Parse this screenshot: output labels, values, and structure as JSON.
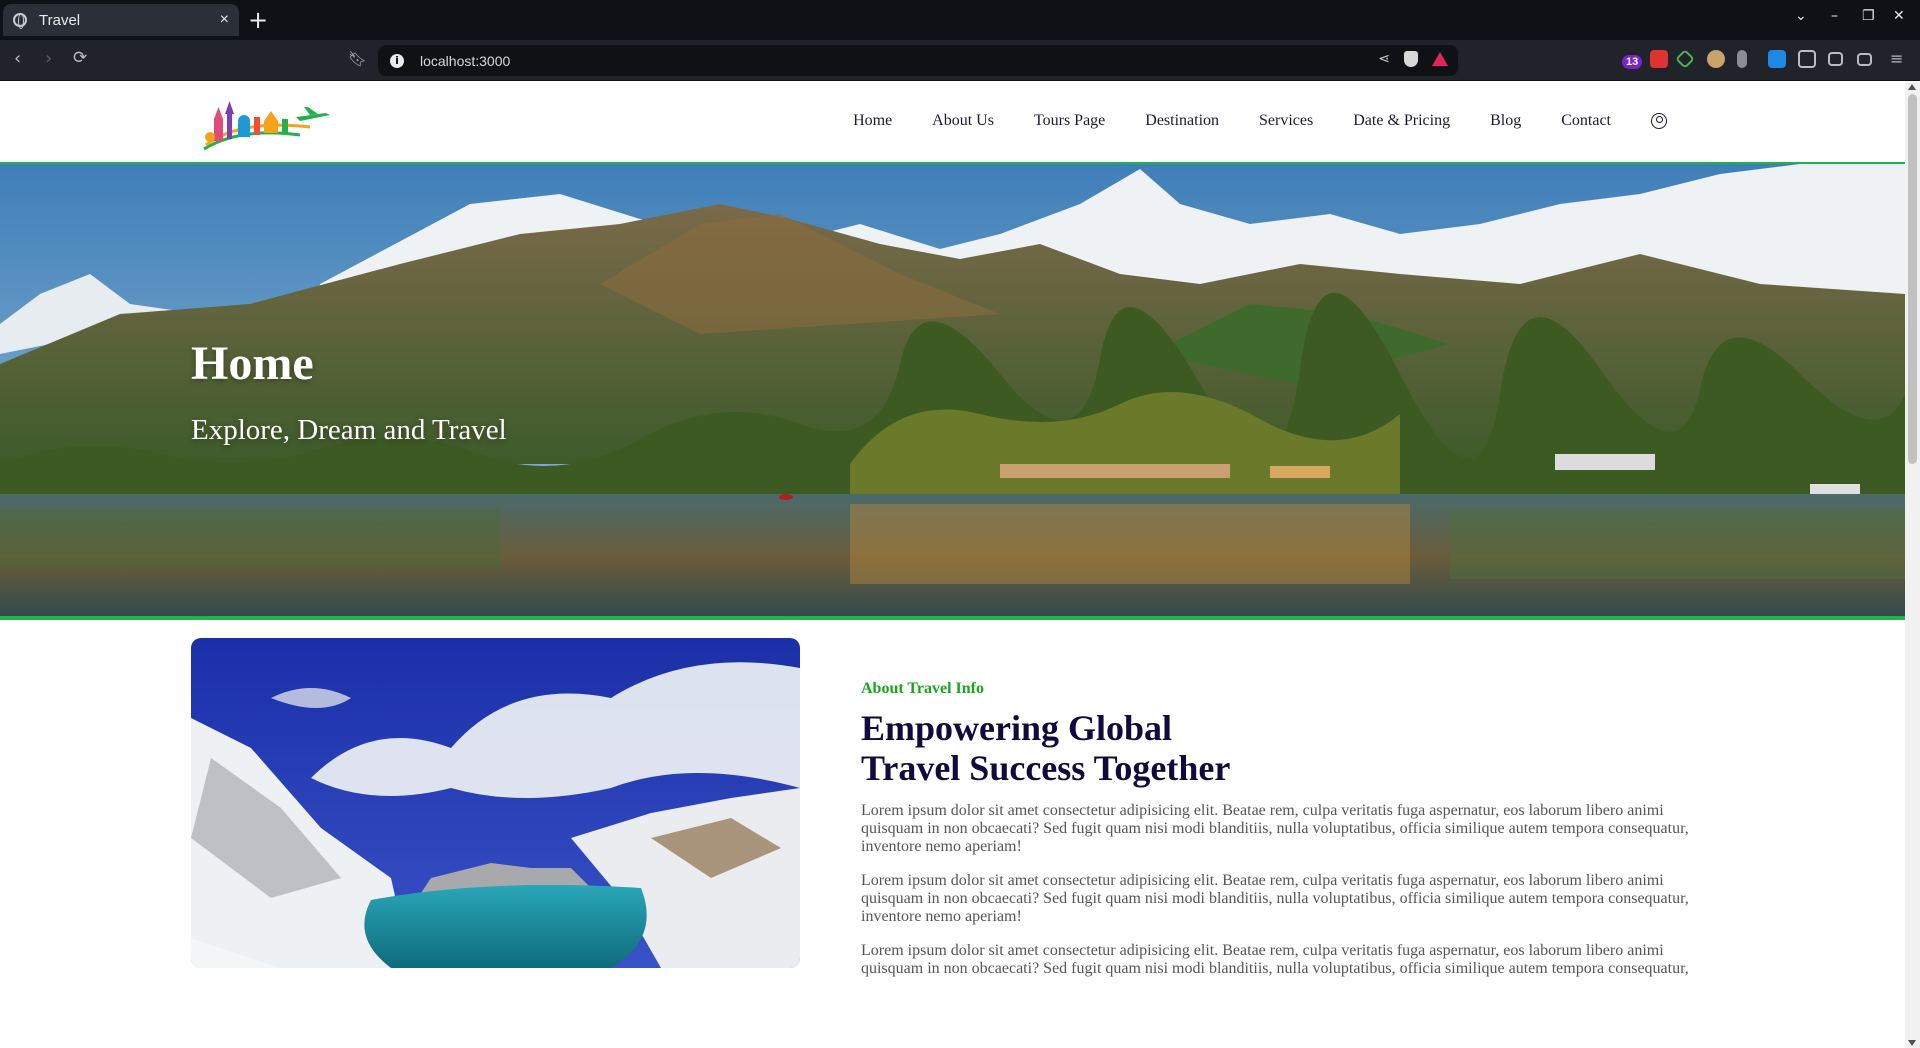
{
  "browser": {
    "tab_title": "Travel",
    "tab_close": "×",
    "new_tab": "+",
    "url": "localhost:3000",
    "extension_badge": "13",
    "window_controls": [
      "⌄",
      "–",
      "❐",
      "✕"
    ]
  },
  "header": {
    "nav": [
      "Home",
      "About Us",
      "Tours Page",
      "Destination",
      "Services",
      "Date & Pricing",
      "Blog",
      "Contact"
    ]
  },
  "hero": {
    "title": "Home",
    "subtitle": "Explore, Dream and Travel"
  },
  "about": {
    "eyebrow": "About Travel Info",
    "headline_line1": "Empowering Global",
    "headline_line2": "Travel Success Together",
    "paragraphs": [
      "Lorem ipsum dolor sit amet consectetur adipisicing elit. Beatae rem, culpa veritatis fuga aspernatur, eos laborum libero animi quisquam in non obcaecati? Sed fugit quam nisi modi blanditiis, nulla voluptatibus, officia similique autem tempora consequatur, inventore nemo aperiam!",
      "Lorem ipsum dolor sit amet consectetur adipisicing elit. Beatae rem, culpa veritatis fuga aspernatur, eos laborum libero animi quisquam in non obcaecati? Sed fugit quam nisi modi blanditiis, nulla voluptatibus, officia similique autem tempora consequatur, inventore nemo aperiam!",
      "Lorem ipsum dolor sit amet consectetur adipisicing elit. Beatae rem, culpa veritatis fuga aspernatur, eos laborum libero animi quisquam in non obcaecati? Sed fugit quam nisi modi blanditiis, nulla voluptatibus, officia similique autem tempora consequatur,"
    ]
  },
  "colors": {
    "accent_green": "#22b14c",
    "eyebrow_green": "#1aa51a",
    "headline_navy": "#120a3d"
  }
}
